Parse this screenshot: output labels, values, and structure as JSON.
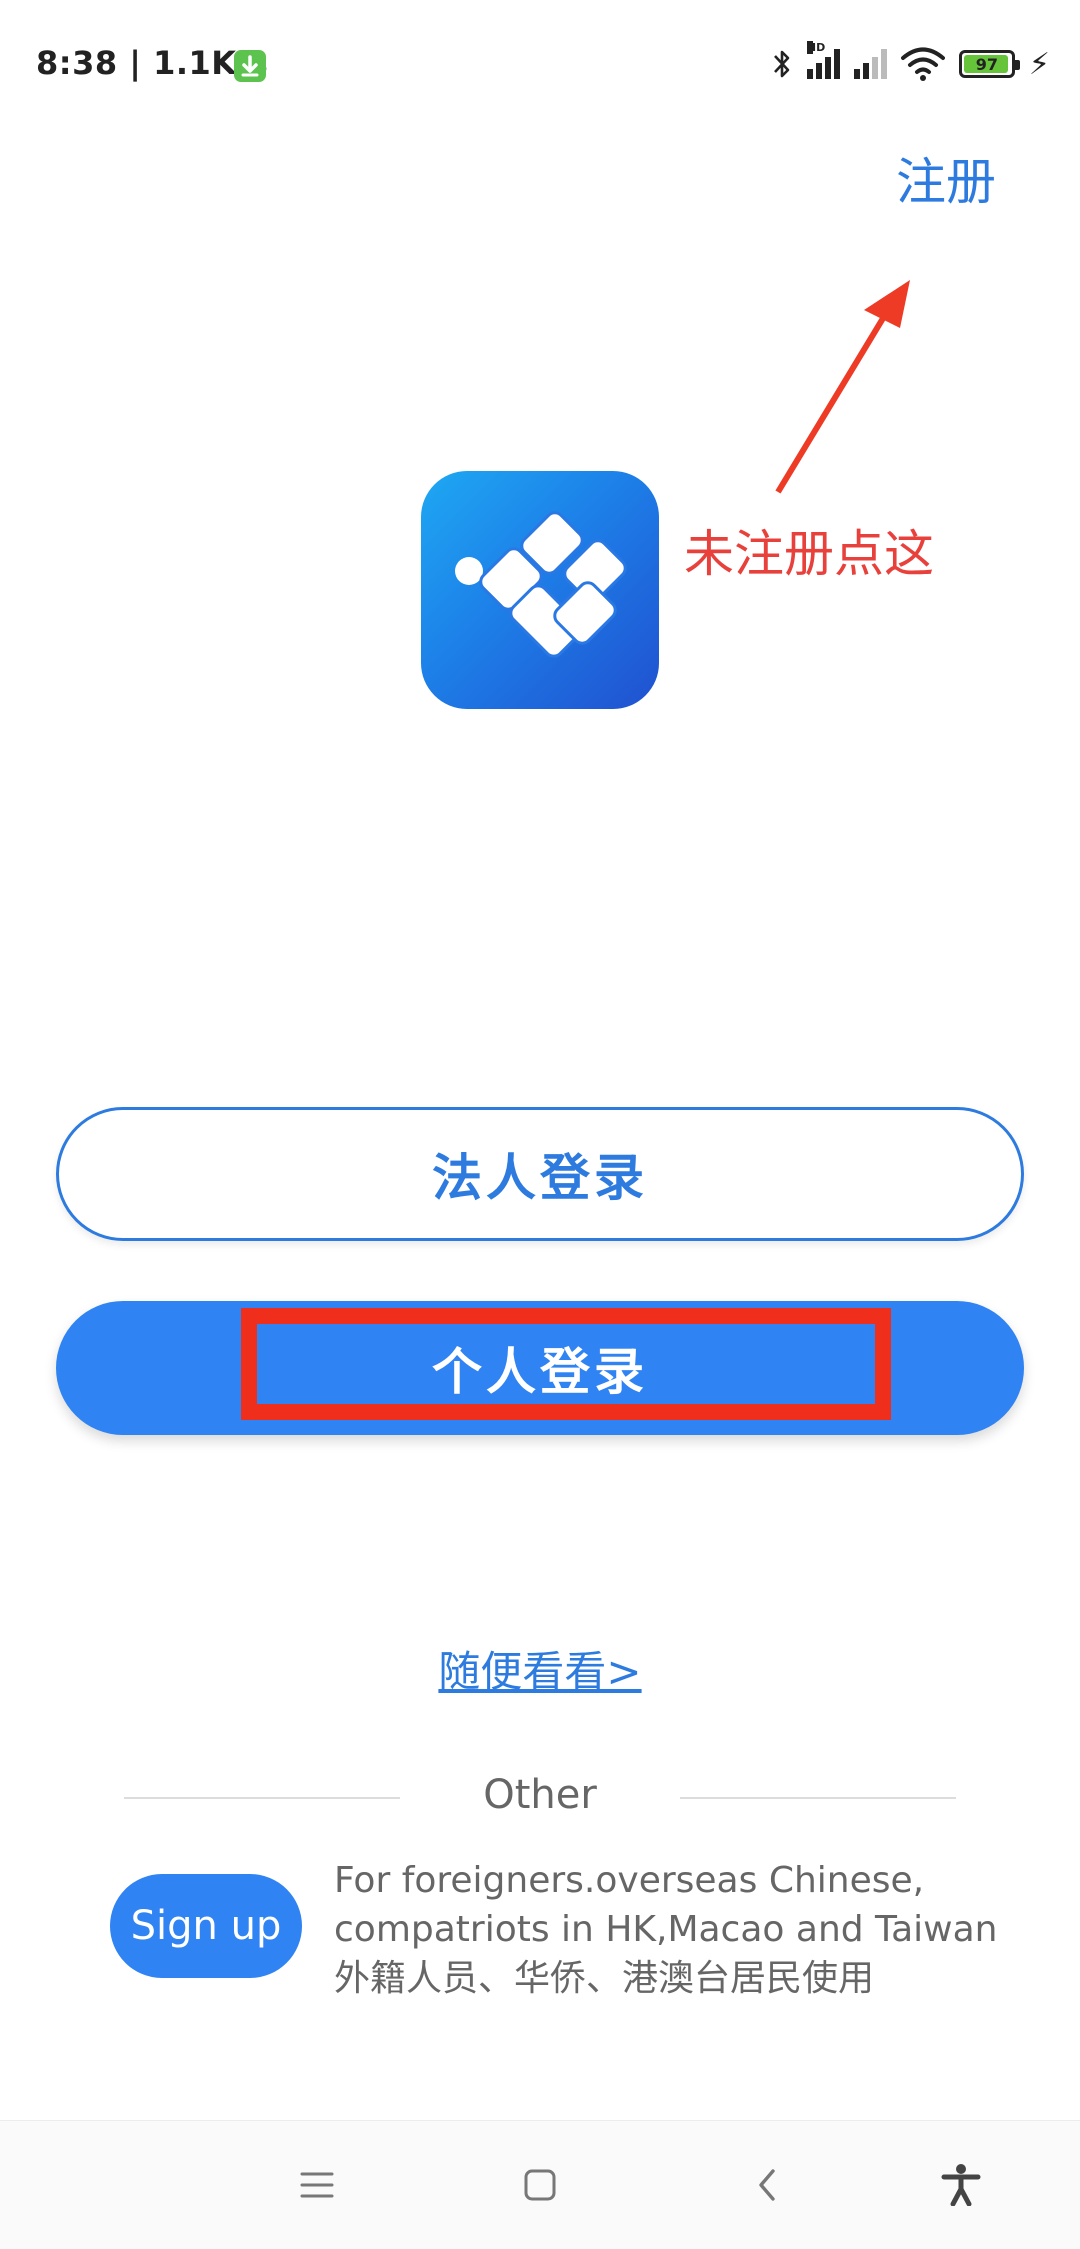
{
  "status_bar": {
    "time_speed": "8:38 | 1.1K/s",
    "network_label": "HD",
    "battery_level": "97"
  },
  "header": {
    "register_label": "注册"
  },
  "annotation": {
    "text": "未注册点这",
    "color": "#e8413c"
  },
  "buttons": {
    "legal_login": "法人登录",
    "personal_login": "个人登录"
  },
  "browse_link": "随便看看>",
  "other": {
    "divider_label": "Other",
    "signup_button": "Sign up",
    "description_lines": [
      "For foreigners.overseas Chinese,",
      "compatriots in HK,Macao and Taiwan",
      "外籍人员、华侨、港澳台居民使用"
    ]
  },
  "nav": {
    "icons": [
      "menu-icon",
      "home-square-icon",
      "back-chevron-icon",
      "accessibility-icon"
    ]
  },
  "colors": {
    "accent": "#2e7be0",
    "button_fill": "#2f83f2",
    "highlight_box": "#ef2f1b"
  }
}
